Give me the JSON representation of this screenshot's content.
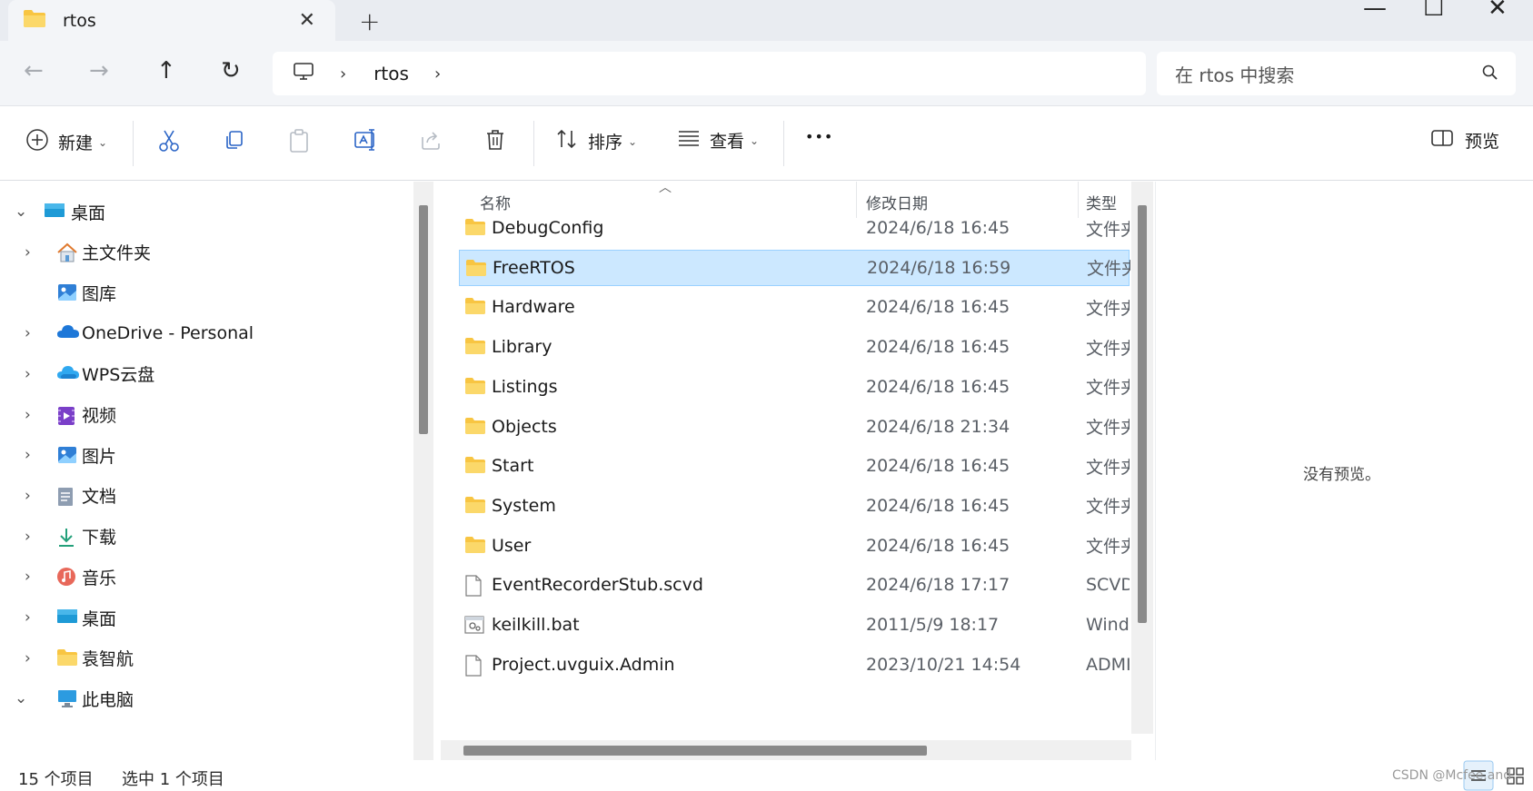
{
  "tab": {
    "title": "rtos",
    "close": "✕",
    "new_tab": "+"
  },
  "window": {
    "minimize": "—",
    "maximize": "☐",
    "close": "✕"
  },
  "nav": {
    "back": "←",
    "forward": "→",
    "up": "↑",
    "refresh": "↻"
  },
  "breadcrumb": {
    "sep": "›",
    "items": [
      "rtos"
    ]
  },
  "search": {
    "placeholder": "在 rtos 中搜索"
  },
  "toolbar": {
    "new_label": "新建",
    "sort_label": "排序",
    "view_label": "查看",
    "more": "•••",
    "preview_label": "预览"
  },
  "sidebar": {
    "items": [
      {
        "label": "桌面",
        "icon": "desktop-icon",
        "expander": "open",
        "root": true
      },
      {
        "label": "主文件夹",
        "icon": "home-icon",
        "expander": "closed"
      },
      {
        "label": "图库",
        "icon": "gallery-icon",
        "expander": "none"
      },
      {
        "label": "OneDrive - Personal",
        "icon": "onedrive-icon",
        "expander": "closed"
      },
      {
        "label": "WPS云盘",
        "icon": "wps-cloud-icon",
        "expander": "closed"
      },
      {
        "label": "视频",
        "icon": "videos-icon",
        "expander": "closed"
      },
      {
        "label": "图片",
        "icon": "pictures-icon",
        "expander": "closed"
      },
      {
        "label": "文档",
        "icon": "documents-icon",
        "expander": "closed"
      },
      {
        "label": "下载",
        "icon": "downloads-icon",
        "expander": "closed"
      },
      {
        "label": "音乐",
        "icon": "music-icon",
        "expander": "closed"
      },
      {
        "label": "桌面",
        "icon": "desktop-icon",
        "expander": "closed"
      },
      {
        "label": "袁智航",
        "icon": "folder-icon",
        "expander": "closed"
      },
      {
        "label": "此电脑",
        "icon": "this-pc-icon",
        "expander": "open"
      }
    ]
  },
  "list": {
    "columns": {
      "name": "名称",
      "date": "修改日期",
      "type": "类型"
    },
    "rows": [
      {
        "name": "DebugConfig",
        "date": "2024/6/18 16:45",
        "type": "文件夹",
        "kind": "folder"
      },
      {
        "name": "FreeRTOS",
        "date": "2024/6/18 16:59",
        "type": "文件夹",
        "kind": "folder",
        "selected": true
      },
      {
        "name": "Hardware",
        "date": "2024/6/18 16:45",
        "type": "文件夹",
        "kind": "folder"
      },
      {
        "name": "Library",
        "date": "2024/6/18 16:45",
        "type": "文件夹",
        "kind": "folder"
      },
      {
        "name": "Listings",
        "date": "2024/6/18 16:45",
        "type": "文件夹",
        "kind": "folder"
      },
      {
        "name": "Objects",
        "date": "2024/6/18 21:34",
        "type": "文件夹",
        "kind": "folder"
      },
      {
        "name": "Start",
        "date": "2024/6/18 16:45",
        "type": "文件夹",
        "kind": "folder"
      },
      {
        "name": "System",
        "date": "2024/6/18 16:45",
        "type": "文件夹",
        "kind": "folder"
      },
      {
        "name": "User",
        "date": "2024/6/18 16:45",
        "type": "文件夹",
        "kind": "folder"
      },
      {
        "name": "EventRecorderStub.scvd",
        "date": "2024/6/18 17:17",
        "type": "SCVD",
        "kind": "file"
      },
      {
        "name": "keilkill.bat",
        "date": "2011/5/9 18:17",
        "type": "Windows",
        "kind": "bat"
      },
      {
        "name": "Project.uvguix.Admin",
        "date": "2023/10/21 14:54",
        "type": "ADMIN",
        "kind": "file"
      }
    ]
  },
  "preview": {
    "empty_text": "没有预览。"
  },
  "status": {
    "count": "15 个项目",
    "selected": "选中 1 个项目"
  },
  "watermark": "CSDN @Mcfee.and",
  "colors": {
    "selection": "#cce8ff",
    "selection_border": "#99d1ff",
    "folder": "#f8c542",
    "accent": "#0067c0"
  }
}
